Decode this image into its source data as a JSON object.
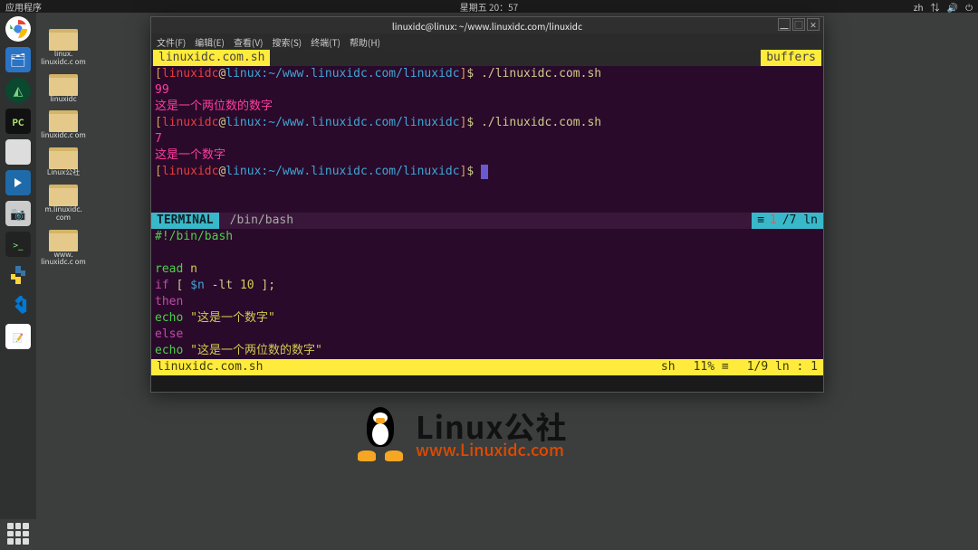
{
  "panel": {
    "apps_label": "应用程序",
    "clock": "星期五 20：57",
    "lang": "zh",
    "tray_icons": [
      "network-icon",
      "volume-icon",
      "power-icon"
    ]
  },
  "dock_items": [
    {
      "name": "chrome-icon",
      "bg": "#fff"
    },
    {
      "name": "files-icon",
      "bg": "#2b73c4"
    },
    {
      "name": "android-studio-icon",
      "bg": "#0a4830"
    },
    {
      "name": "pycharm-icon",
      "bg": "#1a1a1a"
    },
    {
      "name": "app-icon-1",
      "bg": "#ddd"
    },
    {
      "name": "app-icon-2",
      "bg": "#1f6aa8"
    },
    {
      "name": "camera-icon",
      "bg": "#ccc"
    },
    {
      "name": "terminal-icon",
      "bg": "#222"
    },
    {
      "name": "python-icon",
      "bg": "transparent"
    },
    {
      "name": "vscode-icon",
      "bg": "transparent"
    },
    {
      "name": "gedit-icon",
      "bg": "transparent"
    }
  ],
  "desktop_icons": [
    "linux.\nlinuxidc.c\nom",
    "linuxidc",
    "linuxidc.c\nom",
    "Linux公社",
    "m.linuxidc.\ncom",
    "www.\nlinuxidc.c\nom"
  ],
  "window": {
    "title": "linuxidc@linux: ~/www.linuxidc.com/linuxidc",
    "menu": [
      "文件(F)",
      "编辑(E)",
      "查看(V)",
      "搜索(S)",
      "终端(T)",
      "帮助(H)"
    ],
    "buffer_tab": "linuxidc.com.sh",
    "buffers_label": "buffers",
    "prompt": {
      "user": "linuxidc",
      "host": "linux",
      "path": "~/www.linuxidc.com/linuxidc"
    },
    "runs": [
      {
        "cmd": "./linuxidc.com.sh",
        "input": "99",
        "output": "这是一个两位数的数字"
      },
      {
        "cmd": "./linuxidc.com.sh",
        "input": "7",
        "output": "这是一个数字"
      }
    ],
    "divider": {
      "label": "TERMINAL",
      "path": "/bin/bash",
      "pos": "1",
      "total": "/7 ln"
    },
    "script": {
      "shebang": "#!/bin/bash",
      "lines": [
        {
          "k": "read",
          "rest": " n"
        },
        {
          "k": "if",
          "rest": " [ $n -lt 10 ];"
        },
        {
          "k": "then",
          "rest": ""
        },
        {
          "k": "echo",
          "str": "\"这是一个数字\""
        },
        {
          "k": "else",
          "rest": ""
        },
        {
          "k": "echo",
          "str": "\"这是一个两位数的数字\""
        }
      ]
    },
    "status": {
      "filename": "linuxidc.com.sh",
      "filetype": "sh",
      "percent": "11% ≡",
      "position": "1/9 ln :  1"
    }
  },
  "brand": {
    "title": "Linux公社",
    "url": "www.Linuxidc.com"
  }
}
